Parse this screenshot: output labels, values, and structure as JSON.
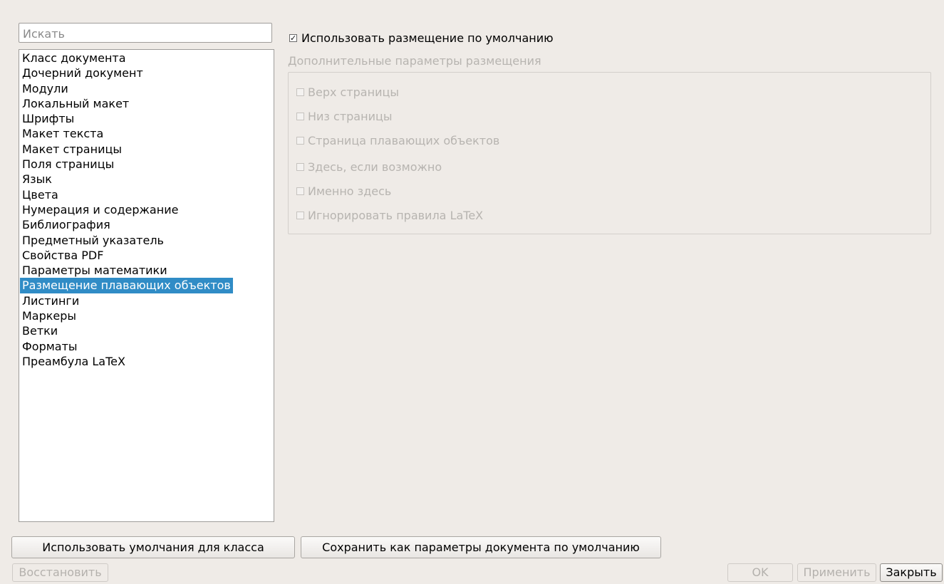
{
  "search": {
    "placeholder": "Искать",
    "value": ""
  },
  "sidebar": {
    "items": [
      {
        "label": "Класс документа"
      },
      {
        "label": "Дочерний документ"
      },
      {
        "label": "Модули"
      },
      {
        "label": "Локальный макет"
      },
      {
        "label": "Шрифты"
      },
      {
        "label": "Макет текста"
      },
      {
        "label": "Макет страницы"
      },
      {
        "label": "Поля страницы"
      },
      {
        "label": "Язык"
      },
      {
        "label": "Цвета"
      },
      {
        "label": "Нумерация и содержание"
      },
      {
        "label": "Библиография"
      },
      {
        "label": "Предметный указатель"
      },
      {
        "label": "Свойства PDF"
      },
      {
        "label": "Параметры математики"
      },
      {
        "label": "Размещение плавающих объектов",
        "selected": true
      },
      {
        "label": "Листинги"
      },
      {
        "label": "Маркеры"
      },
      {
        "label": "Ветки"
      },
      {
        "label": "Форматы"
      },
      {
        "label": "Преамбула LaTeX"
      }
    ]
  },
  "placement": {
    "use_default_label": "Использовать размещение по умолчанию",
    "use_default_checked": true,
    "advanced_title": "Дополнительные параметры размещения",
    "options": {
      "top": "Верх страницы",
      "bottom": "Низ страницы",
      "float_page": "Страница плавающих объектов",
      "here_if_possible": "Здесь, если возможно",
      "here_definitely": "Именно здесь",
      "ignore_latex": "Игнорировать правила LaTeX"
    }
  },
  "buttons": {
    "use_class_defaults": "Использовать умолчания для класса",
    "save_as_default": "Сохранить как параметры документа по умолчанию",
    "restore": "Восстановить",
    "ok": "OK",
    "apply": "Применить",
    "close": "Закрыть"
  },
  "colors": {
    "background": "#efebe7",
    "selection": "#308cc6",
    "disabled_text": "#b7b4b0"
  }
}
